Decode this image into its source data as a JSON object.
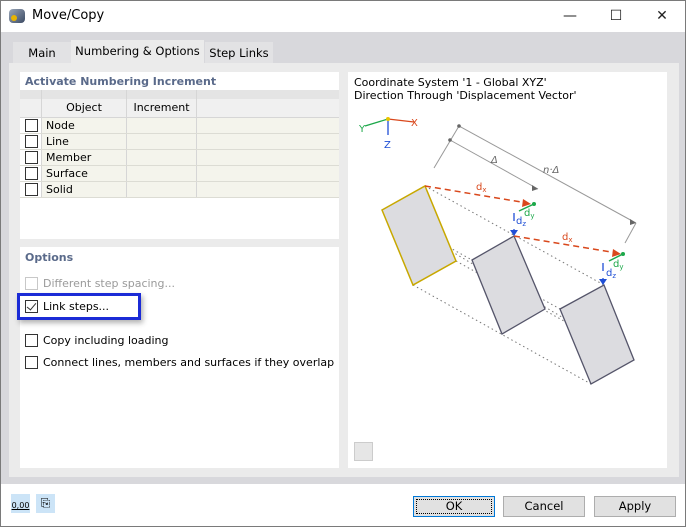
{
  "window": {
    "title": "Move/Copy",
    "controls": {
      "minimize": "—",
      "maximize": "☐",
      "close": "✕"
    }
  },
  "tabs": [
    {
      "label": "Main",
      "active": false
    },
    {
      "label": "Numbering & Options",
      "active": true
    },
    {
      "label": "Step Links",
      "active": false
    }
  ],
  "numbering": {
    "header": "Activate Numbering Increment",
    "columns": [
      "Object",
      "Increment"
    ],
    "rows": [
      {
        "object": "Node",
        "checked": false,
        "increment": ""
      },
      {
        "object": "Line",
        "checked": false,
        "increment": ""
      },
      {
        "object": "Member",
        "checked": false,
        "increment": ""
      },
      {
        "object": "Surface",
        "checked": false,
        "increment": ""
      },
      {
        "object": "Solid",
        "checked": false,
        "increment": ""
      }
    ]
  },
  "options": {
    "header": "Options",
    "items": [
      {
        "label": "Different step spacing...",
        "checked": false,
        "enabled": false
      },
      {
        "label": "Link steps...",
        "checked": true,
        "enabled": true,
        "highlighted": true
      },
      {
        "label": "Copy including loading",
        "checked": false,
        "enabled": true
      },
      {
        "label": "Connect lines, members and surfaces if they overlap",
        "checked": false,
        "enabled": true
      }
    ]
  },
  "preview": {
    "line1": "Coordinate System '1 - Global XYZ'",
    "line2": "Direction Through 'Displacement Vector'",
    "axes": {
      "x": "X",
      "y": "Y",
      "z": "Z"
    },
    "labels": {
      "delta": "Δ",
      "n_delta": "n·Δ",
      "dx": "d",
      "dy": "d",
      "dz": "d",
      "sub_x": "x",
      "sub_y": "y",
      "sub_z": "z"
    },
    "colors": {
      "x": "#d9481c",
      "y": "#1ca84a",
      "z": "#1f4fd6",
      "selected": "#c8a800"
    }
  },
  "footer": {
    "units_icon_text": "0,00",
    "ok": "OK",
    "cancel": "Cancel",
    "apply": "Apply"
  }
}
